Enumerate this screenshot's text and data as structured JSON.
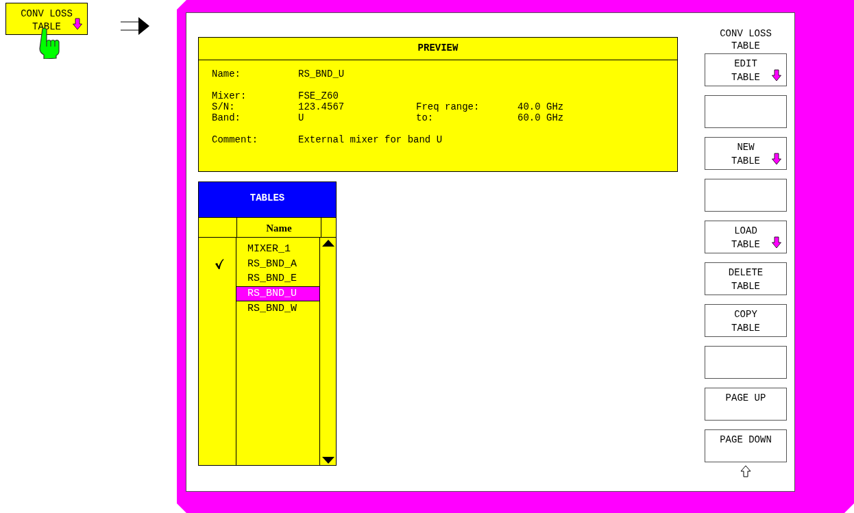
{
  "pressed_softkey": {
    "lines": [
      "CONV LOSS",
      "TABLE"
    ],
    "submenu": true
  },
  "preview": {
    "title": "PREVIEW",
    "groups": [
      [
        [
          {
            "label": "Name:",
            "value": "RS_BND_U"
          }
        ]
      ],
      [
        [
          {
            "label": "Mixer:",
            "value": "FSE_Z60"
          }
        ],
        [
          {
            "label": "S/N:",
            "value": "123.4567"
          },
          {
            "label": "Freq range:",
            "value": "40.0 GHz"
          }
        ],
        [
          {
            "label": "Band:",
            "value": "U"
          },
          {
            "label": "to:",
            "value": "60.0 GHz"
          }
        ]
      ],
      [
        [
          {
            "label": "Comment:",
            "value": "External mixer for band U"
          }
        ]
      ]
    ]
  },
  "tables": {
    "title": "TABLES",
    "column": "Name",
    "items": [
      {
        "name": "MIXER_1",
        "checked": false,
        "selected": false
      },
      {
        "name": "RS_BND_A",
        "checked": true,
        "selected": false
      },
      {
        "name": "RS_BND_E",
        "checked": false,
        "selected": false
      },
      {
        "name": "RS_BND_U",
        "checked": false,
        "selected": true
      },
      {
        "name": "RS_BND_W",
        "checked": false,
        "selected": false
      }
    ]
  },
  "softkey_menu": {
    "title": [
      "CONV LOSS",
      "TABLE"
    ],
    "softkeys": [
      {
        "kind": "key",
        "lines": [
          "EDIT",
          "TABLE"
        ],
        "submenu": true
      },
      {
        "kind": "blank"
      },
      {
        "kind": "key",
        "lines": [
          "NEW",
          "TABLE"
        ],
        "submenu": true
      },
      {
        "kind": "blank"
      },
      {
        "kind": "key",
        "lines": [
          "LOAD",
          "TABLE"
        ],
        "submenu": true
      },
      {
        "kind": "key",
        "lines": [
          "DELETE",
          "TABLE"
        ],
        "submenu": false
      },
      {
        "kind": "key",
        "lines": [
          "COPY",
          "TABLE"
        ],
        "submenu": false
      },
      {
        "kind": "blank"
      },
      {
        "kind": "key",
        "lines": [
          "PAGE UP"
        ],
        "submenu": false
      },
      {
        "kind": "key",
        "lines": [
          "PAGE DOWN"
        ],
        "submenu": false
      }
    ]
  }
}
